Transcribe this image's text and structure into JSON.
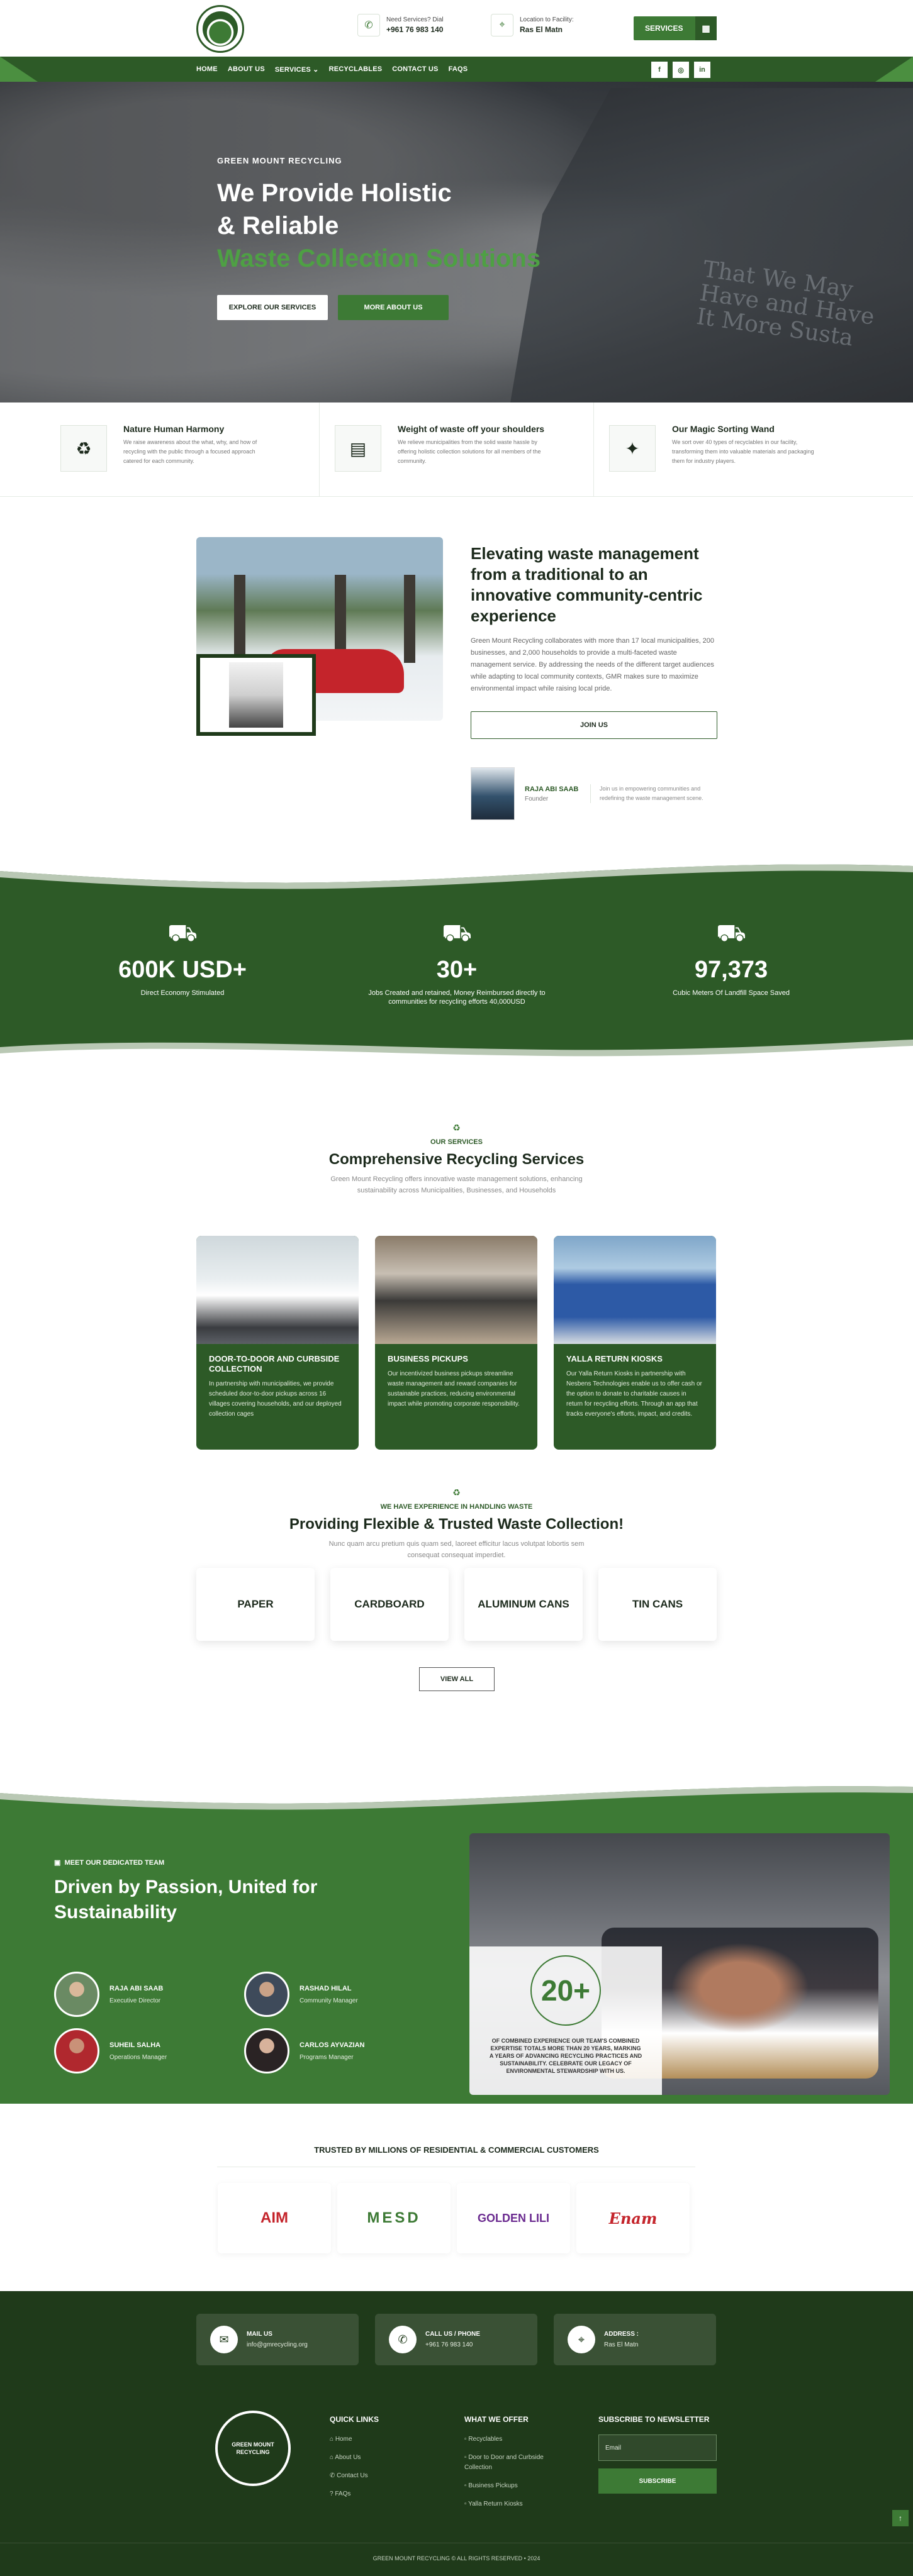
{
  "header": {
    "contact_need": {
      "label": "Need Services? Dial",
      "value": "+961 76 983 140"
    },
    "contact_location": {
      "label": "Location to Facility:",
      "value": "Ras El Matn"
    },
    "services_button": "SERVICES"
  },
  "nav": {
    "items": [
      "HOME",
      "ABOUT US",
      "SERVICES ⌄",
      "RECYCLABLES",
      "CONTACT US",
      "FAQS"
    ],
    "social": [
      "f",
      "◎",
      "in"
    ]
  },
  "hero": {
    "eyebrow": "GREEN MOUNT RECYCLING",
    "title_line1": "We Provide Holistic",
    "title_line2": "& Reliable",
    "title_line3": "Waste Collection Solutions",
    "btn_explore": "EXPLORE OUR SERVICES",
    "btn_about": "MORE ABOUT US",
    "truck_text": "That We May Have and Have It More Susta"
  },
  "features": [
    {
      "title": "Nature Human Harmony",
      "text": "We raise awareness about the what, why, and how of recycling with the public through a focused approach catered for each community."
    },
    {
      "title": "Weight of waste off your shoulders",
      "text": "We relieve municipalities from the solid waste hassle by offering holistic collection solutions for all members of the community."
    },
    {
      "title": "Our Magic Sorting Wand",
      "text": "We sort over 40 types of recyclables in our facility, transforming them into valuable materials and packaging them for industry players."
    }
  ],
  "about": {
    "title": "Elevating waste management from a traditional to an innovative community-centric experience",
    "body": "Green Mount Recycling collaborates with more than 17 local municipalities, 200 businesses, and 2,000 households to provide a multi-faceted waste management service. By addressing the needs of the different target audiences while adapting to local community contexts, GMR makes sure to maximize environmental impact while raising local pride.",
    "join_button": "JOIN US",
    "founder_name": "RAJA ABI SAAB",
    "founder_role": "Founder",
    "founder_quote": "Join us in empowering communities and redefining the waste management scene."
  },
  "stats": [
    {
      "value": "600K USD+",
      "label": "Direct Economy Stimulated"
    },
    {
      "value": "30+",
      "label": "Jobs Created and retained, Money Reimbursed directly to communities for recycling efforts 40,000USD"
    },
    {
      "value": "97,373",
      "label": "Cubic Meters Of Landfill Space Saved"
    }
  ],
  "services": {
    "eyebrow": "OUR SERVICES",
    "title": "Comprehensive Recycling Services",
    "subtitle": "Green Mount Recycling offers innovative waste management solutions, enhancing sustainability across Municipalities, Businesses, and Households",
    "cards": [
      {
        "title": "DOOR-TO-DOOR AND CURBSIDE COLLECTION",
        "text": "In partnership with municipalities, we provide scheduled door-to-door pickups across 16 villages covering households, and our deployed collection cages"
      },
      {
        "title": "BUSINESS PICKUPS",
        "text": "Our incentivized business pickups streamline waste management and reward companies for sustainable practices, reducing environmental impact while promoting corporate responsibility."
      },
      {
        "title": "YALLA RETURN KIOSKS",
        "text": "Our Yalla Return Kiosks in partnership with Nesbens Technologies enable us to offer cash or the option to donate to charitable causes in return for recycling efforts. Through an app that tracks everyone's efforts, impact, and credits."
      }
    ]
  },
  "waste": {
    "eyebrow": "WE HAVE EXPERIENCE IN HANDLING WASTE",
    "title": "Providing Flexible & Trusted Waste Collection!",
    "subtitle": "Nunc quam arcu pretium quis quam sed, laoreet efficitur lacus volutpat lobortis sem consequat consequat imperdiet.",
    "types": [
      "PAPER",
      "CARDBOARD",
      "ALUMINUM CANS",
      "TIN CANS"
    ],
    "view_all": "VIEW ALL"
  },
  "team": {
    "eyebrow": "MEET OUR DEDICATED TEAM",
    "title": "Driven by Passion, United for Sustainability",
    "members": [
      {
        "name": "RAJA ABI SAAB",
        "role": "Executive Director"
      },
      {
        "name": "RASHAD HILAL",
        "role": "Community Manager"
      },
      {
        "name": "SUHEIL SALHA",
        "role": "Operations Manager"
      },
      {
        "name": "CARLOS AYVAZIAN",
        "role": "Programs Manager"
      }
    ],
    "badge_number": "20+",
    "badge_text": "OF COMBINED EXPERIENCE OUR TEAM'S COMBINED EXPERTISE TOTALS MORE THAN 20 YEARS, MARKING A YEARS OF ADVANCING RECYCLING PRACTICES AND SUSTAINABILITY. CELEBRATE OUR LEGACY OF ENVIRONMENTAL STEWARDSHIP WITH US."
  },
  "clients": {
    "title": "TRUSTED BY MILLIONS OF RESIDENTIAL & COMMERCIAL CUSTOMERS",
    "logos": [
      {
        "name": "AIM",
        "color": "#c4242b"
      },
      {
        "name": "MESD",
        "color": "#3d7a35"
      },
      {
        "name": "GOLDEN LILI",
        "color": "#6a2a8f"
      },
      {
        "name": "Enam",
        "color": "#c4242b"
      }
    ]
  },
  "footer": {
    "mail_label": "MAIL US",
    "mail_value": "info@gmrecycling.org",
    "call_label": "CALL US / PHONE",
    "call_value": "+961 76 983 140",
    "address_label": "ADDRESS :",
    "address_value": "Ras El Matn",
    "logo_text": "GREEN MOUNT RECYCLING",
    "quick_links_title": "QUICK LINKS",
    "quick_links": [
      "Home",
      "About Us",
      "Contact Us",
      "FAQs"
    ],
    "offer_title": "WHAT WE OFFER",
    "offer": [
      "Recyclables",
      "Door to Door and Curbside Collection",
      "Business Pickups",
      "Yalla Return Kiosks"
    ],
    "newsletter_title": "SUBSCRIBE TO NEWSLETTER",
    "email_placeholder": "Email",
    "subscribe": "SUBSCRIBE",
    "copyright": "GREEN MOUNT RECYCLING © ALL RIGHTS RESERVED • 2024"
  },
  "colors": {
    "brand_dark": "#2d5a27",
    "brand": "#3d7a35",
    "footer": "#1f3a1a",
    "hero_accent": "#4ea044"
  }
}
